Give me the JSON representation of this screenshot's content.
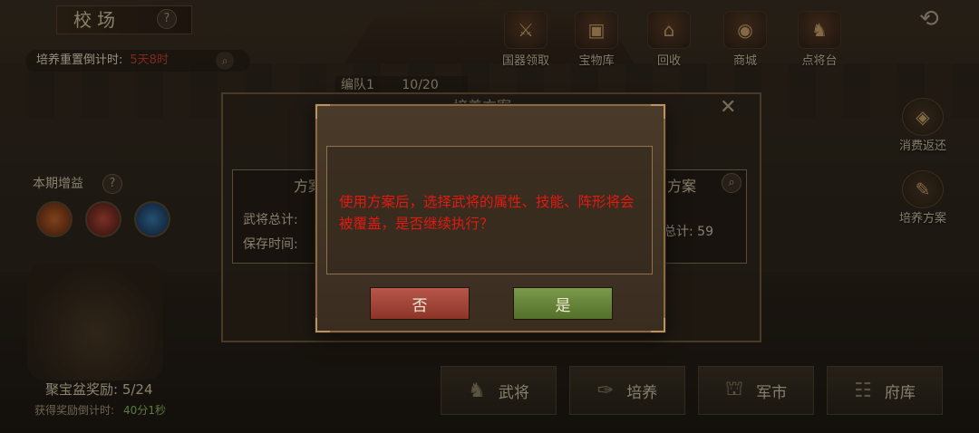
{
  "header": {
    "title": "校场",
    "help": "?",
    "back_icon": "back-arrow-icon"
  },
  "reset": {
    "label": "培养重置倒计时:",
    "value": "5天8时"
  },
  "top_nav": [
    {
      "label": "国器领取",
      "icon": "crossed-swords-icon"
    },
    {
      "label": "宝物库",
      "icon": "treasure-chest-icon"
    },
    {
      "label": "回收",
      "icon": "gate-icon"
    },
    {
      "label": "商城",
      "icon": "coin-bag-icon"
    },
    {
      "label": "点将台",
      "icon": "general-icon"
    }
  ],
  "formation": {
    "label": "编队1",
    "count": "10/20"
  },
  "right_side": [
    {
      "label": "消费返还",
      "icon": "refund-icon"
    },
    {
      "label": "培养方案",
      "icon": "plan-icon"
    }
  ],
  "period": {
    "label": "本期增益",
    "help": "?"
  },
  "reward": {
    "label": "聚宝盆奖励: 5/24",
    "time_label": "获得奖励倒计时:",
    "time_value": "40分1秒"
  },
  "bottom_nav": [
    {
      "label": "武将",
      "icon": "general-icon"
    },
    {
      "label": "培养",
      "icon": "scroll-icon"
    },
    {
      "label": "军市",
      "icon": "market-icon"
    },
    {
      "label": "府库",
      "icon": "storehouse-icon"
    }
  ],
  "panel": {
    "title": "培养方案",
    "help": "?",
    "close": "✕",
    "left_card": {
      "head": "方案",
      "line1": "武将总计:",
      "line2": "保存时间:"
    },
    "right_card": {
      "head": "方案",
      "line1": "总计: 59"
    }
  },
  "dialog": {
    "message": "使用方案后，选择武将的属性、技能、阵形将会被覆盖，是否继续执行？",
    "no_label": "否",
    "yes_label": "是"
  },
  "colors": {
    "warning_text": "#e21a12",
    "no_button": "#a04538",
    "yes_button": "#6a8a3c"
  }
}
